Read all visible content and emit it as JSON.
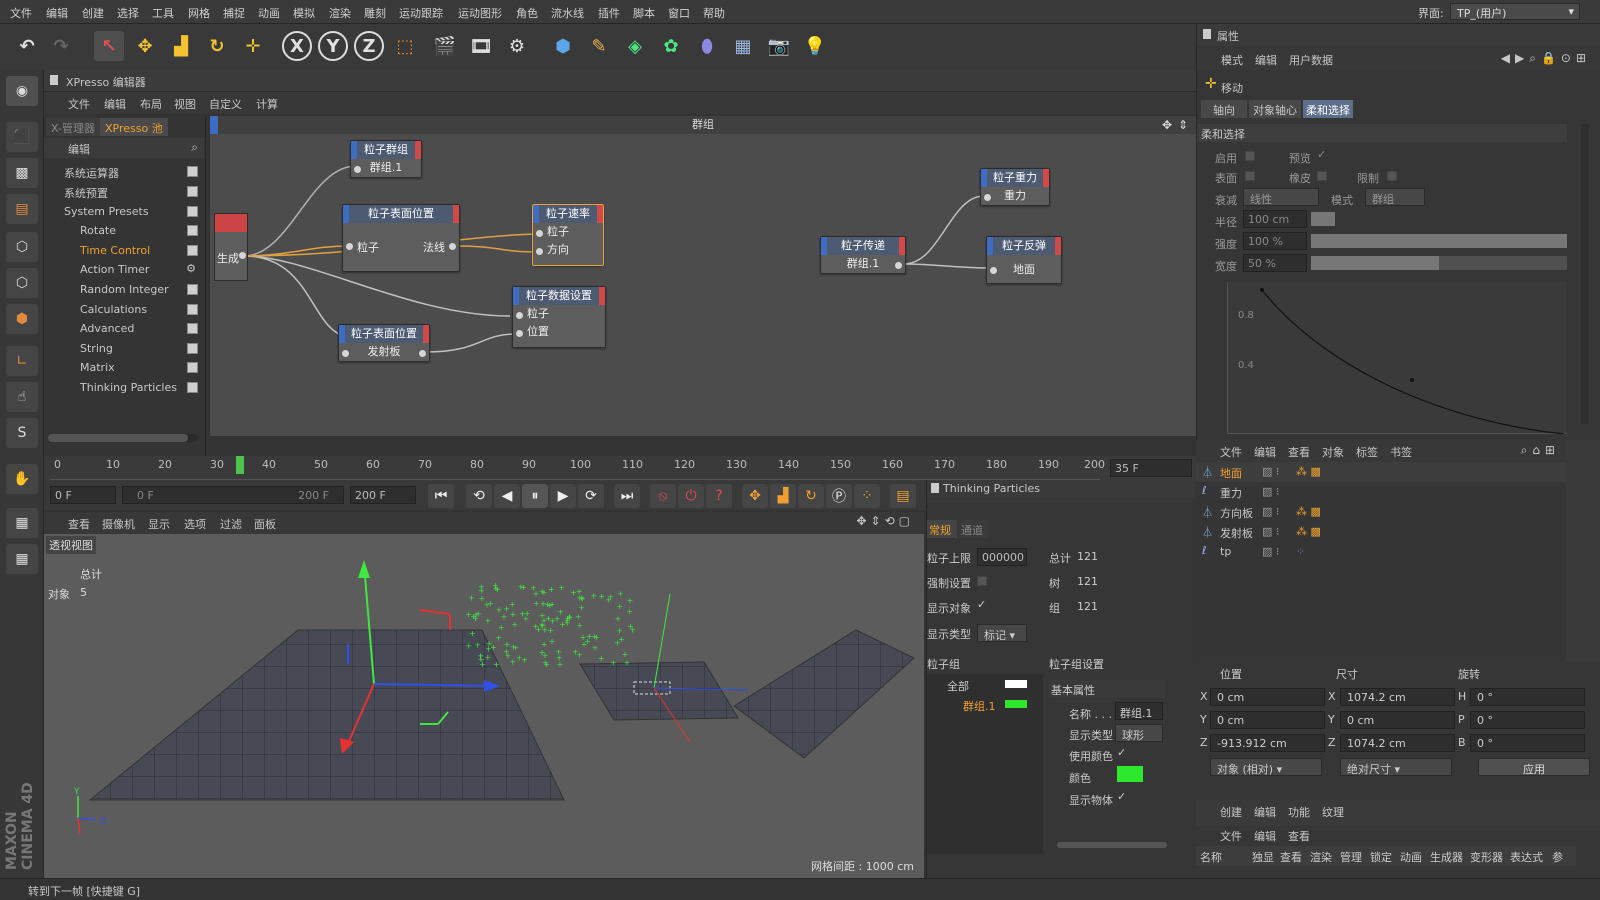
{
  "menubar": {
    "items": [
      "文件",
      "编辑",
      "创建",
      "选择",
      "工具",
      "网格",
      "捕捉",
      "动画",
      "模拟",
      "渲染",
      "雕刻",
      "运动跟踪",
      "运动图形",
      "角色",
      "流水线",
      "插件",
      "脚本",
      "窗口",
      "帮助"
    ],
    "layout_label": "界面:",
    "layout_value": "TP_(用户)"
  },
  "xpresso": {
    "title": "XPresso 编辑器",
    "menu": [
      "文件",
      "编辑",
      "布局",
      "视图",
      "自定义",
      "计算"
    ],
    "tabs": [
      "X-管理器",
      "XPresso 池"
    ],
    "edit_label": "编辑",
    "tree": [
      "系统运算器",
      "系统预置",
      "System Presets",
      "Rotate",
      "Time Control",
      "Action Timer",
      "Random Integer",
      "Calculations",
      "Advanced",
      "String",
      "Matrix",
      "Thinking Particles"
    ],
    "group_title": "群组",
    "nodes": {
      "pgroup": {
        "title": "粒子群组",
        "port": "群组.1"
      },
      "surface1": {
        "title": "粒子表面位置",
        "in": "粒子",
        "out": "法线"
      },
      "speed": {
        "title": "粒子速率",
        "p1": "粒子",
        "p2": "方向"
      },
      "data": {
        "title": "粒子数据设置",
        "p1": "粒子",
        "p2": "位置"
      },
      "surface2": {
        "title": "粒子表面位置",
        "port": "发射板"
      },
      "pass": {
        "title": "粒子传递",
        "port": "群组.1"
      },
      "gravity": {
        "title": "粒子重力",
        "port": "重力"
      },
      "bounce": {
        "title": "粒子反弹",
        "port": "地面"
      },
      "gen": {
        "port": "生成"
      }
    }
  },
  "timeline": {
    "ticks": [
      "0",
      "10",
      "20",
      "30",
      "40",
      "50",
      "60",
      "70",
      "80",
      "90",
      "100",
      "110",
      "120",
      "130",
      "140",
      "150",
      "160",
      "170",
      "180",
      "190",
      "200"
    ],
    "current": "35 F",
    "start": "0 F",
    "range_start": "0 F",
    "range_end": "200 F",
    "end": "200 F"
  },
  "viewport": {
    "menu": [
      "查看",
      "摄像机",
      "显示",
      "选项",
      "过滤",
      "面板"
    ],
    "name": "透视视图",
    "total_label": "总计",
    "objects_label": "对象",
    "objects_value": "5",
    "grid_label": "网格间距 : 1000 cm"
  },
  "tp": {
    "title": "Thinking Particles",
    "tabs": [
      "常规",
      "通道"
    ],
    "max_label": "粒子上限",
    "max_value": "000000",
    "total_label": "总计",
    "total_value": "121",
    "force_label": "强制设置",
    "tree_label": "树",
    "tree_value": "121",
    "show_obj_label": "显示对象",
    "group_label": "组",
    "group_value": "121",
    "display_label": "显示类型",
    "display_value": "标记",
    "pgroup_label": "粒子组",
    "pgroup_settings_label": "粒子组设置",
    "groups": [
      "全部",
      "群组.1"
    ],
    "basic_label": "基本属性",
    "name_label": "名称 . . .",
    "name_value": "群组.1",
    "dtype_label": "显示类型",
    "dtype_value": "球形",
    "usecolor_label": "使用颜色",
    "color_label": "颜色",
    "color_value": "#2ee82e",
    "showobj_label": "显示物体"
  },
  "attributes": {
    "title": "属性",
    "menu": [
      "模式",
      "编辑",
      "用户数据"
    ],
    "tool": "移动",
    "tabs": [
      "轴向",
      "对象轴心",
      "柔和选择"
    ],
    "section": "柔和选择",
    "enable": "启用",
    "preview": "预览",
    "surface": "表面",
    "rubber": "橡皮",
    "restrict": "限制",
    "falloff_label": "衰减",
    "falloff_value": "线性",
    "mode_label": "模式",
    "mode_value": "群组",
    "radius_label": "半径",
    "radius_value": "100 cm",
    "strength_label": "强度",
    "strength_value": "100 %",
    "width_label": "宽度",
    "width_value": "50 %",
    "graph_y": [
      "0.8",
      "0.4"
    ]
  },
  "objects": {
    "menu": [
      "文件",
      "编辑",
      "查看",
      "对象",
      "标签",
      "书签"
    ],
    "rows": [
      "地面",
      "重力",
      "方向板",
      "发射板",
      "tp"
    ]
  },
  "coords": {
    "headers": [
      "位置",
      "尺寸",
      "旋转"
    ],
    "px": "0 cm",
    "py": "0 cm",
    "pz": "-913.912 cm",
    "sx": "1074.2 cm",
    "sy": "0 cm",
    "sz": "1074.2 cm",
    "rh": "0 °",
    "rp": "0 °",
    "rb": "0 °",
    "mode": "对象 (相对)",
    "size_mode": "绝对尺寸",
    "apply": "应用"
  },
  "material": {
    "menu": [
      "创建",
      "编辑",
      "功能",
      "纹理"
    ]
  },
  "layer": {
    "menu": [
      "文件",
      "编辑",
      "查看"
    ],
    "cols": [
      "名称",
      "独显",
      "查看",
      "渲染",
      "管理",
      "锁定",
      "动画",
      "生成器",
      "变形器",
      "表达式",
      "参"
    ]
  },
  "status": "转到下一帧 [快捷键 G]"
}
